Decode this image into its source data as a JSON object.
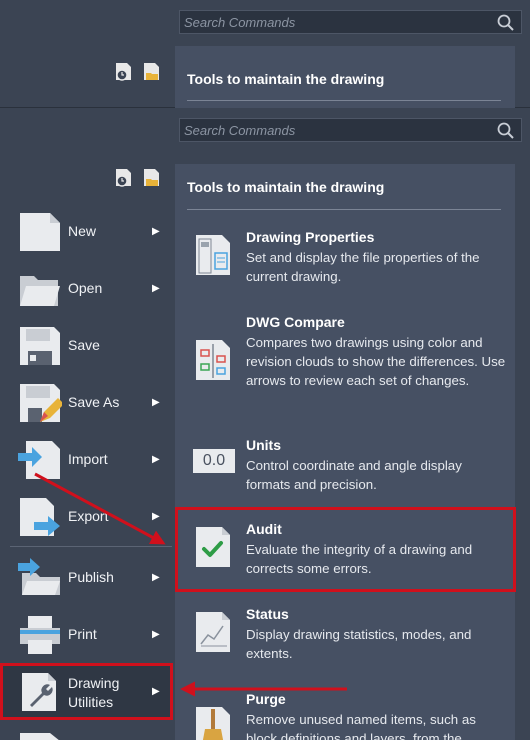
{
  "search": {
    "placeholder": "Search Commands"
  },
  "panel": {
    "heading": "Tools to maintain the drawing"
  },
  "menu": {
    "items": [
      {
        "label": "New",
        "has_submenu": true
      },
      {
        "label": "Open",
        "has_submenu": true
      },
      {
        "label": "Save",
        "has_submenu": false
      },
      {
        "label": "Save As",
        "has_submenu": true
      },
      {
        "label": "Import",
        "has_submenu": true
      },
      {
        "label": "Export",
        "has_submenu": true
      },
      {
        "label": "Publish",
        "has_submenu": true
      },
      {
        "label": "Print",
        "has_submenu": true
      },
      {
        "label": "Drawing\nUtilities",
        "has_submenu": true
      }
    ],
    "arrow_glyph": "▶"
  },
  "tools": [
    {
      "title": "Drawing Properties",
      "desc": "Set and display the file properties of the current drawing."
    },
    {
      "title": "DWG Compare",
      "desc": "Compares two drawings using color and revision clouds to show the differences. Use arrows to review each set of changes."
    },
    {
      "title": "Units",
      "desc": "Control coordinate and angle display formats and precision.",
      "icon_text": "0.0"
    },
    {
      "title": "Audit",
      "desc": "Evaluate the integrity of a drawing and corrects some errors."
    },
    {
      "title": "Status",
      "desc": "Display drawing statistics, modes, and extents."
    },
    {
      "title": "Purge",
      "desc": "Remove unused named items, such as block definitions and layers, from the"
    }
  ],
  "colors": {
    "background": "#3b4453",
    "panel": "#465063",
    "highlight": "#d0101c",
    "accent_blue": "#4aa3df"
  }
}
